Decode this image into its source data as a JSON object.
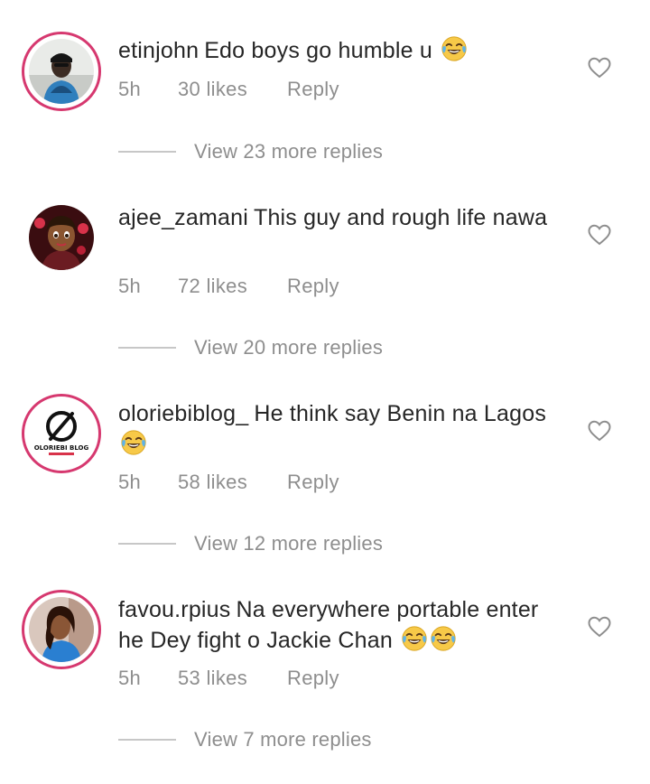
{
  "comments": [
    {
      "username": "etinjohn",
      "text": "Edo boys go humble u",
      "emojis": [
        "joy"
      ],
      "time": "5h",
      "likes": "30 likes",
      "reply": "Reply",
      "view_more": "View 23 more replies"
    },
    {
      "username": "ajee_zamani",
      "text": "This guy and rough life nawa",
      "emojis": [],
      "time": "5h",
      "likes": "72 likes",
      "reply": "Reply",
      "view_more": "View 20 more replies"
    },
    {
      "username": "oloriebiblog_",
      "text": "He think say Benin na Lagos",
      "emojis": [
        "joy"
      ],
      "time": "5h",
      "likes": "58 likes",
      "reply": "Reply",
      "view_more": "View 12 more replies",
      "avatar_logo_text": "OLORIEBI BLOG"
    },
    {
      "username": "favou.rpius",
      "text": "Na everywhere portable enter he Dey fight o Jackie Chan",
      "emojis": [
        "joy",
        "joy"
      ],
      "time": "5h",
      "likes": "53 likes",
      "reply": "Reply",
      "view_more": "View 7 more replies"
    }
  ],
  "colors": {
    "story_ring": "#d6386f",
    "secondary_text": "#8e8e8e",
    "primary_text": "#262626",
    "divider": "#c7c7c7"
  },
  "icons": {
    "like": "heart-outline-icon",
    "emoji": "face-with-tears-of-joy"
  }
}
